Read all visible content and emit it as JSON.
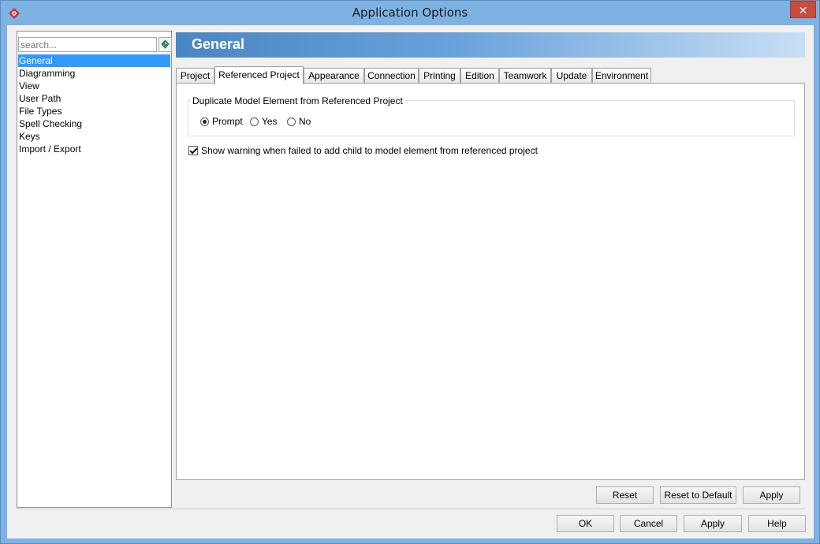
{
  "window": {
    "title": "Application Options",
    "close_glyph": "✕"
  },
  "search": {
    "placeholder": "search..."
  },
  "tree": {
    "items": [
      {
        "label": "General",
        "selected": true
      },
      {
        "label": "Diagramming"
      },
      {
        "label": "View"
      },
      {
        "label": "User Path"
      },
      {
        "label": "File Types"
      },
      {
        "label": "Spell Checking"
      },
      {
        "label": "Keys"
      },
      {
        "label": "Import / Export"
      }
    ]
  },
  "header": {
    "title": "General"
  },
  "tabs": [
    {
      "label": "Project"
    },
    {
      "label": "Referenced Project",
      "active": true
    },
    {
      "label": "Appearance"
    },
    {
      "label": "Connection"
    },
    {
      "label": "Printing"
    },
    {
      "label": "Edition"
    },
    {
      "label": "Teamwork"
    },
    {
      "label": "Update"
    },
    {
      "label": "Environment"
    }
  ],
  "duplicate_group": {
    "title": "Duplicate Model Element from Referenced Project",
    "options": [
      {
        "label": "Prompt",
        "selected": true
      },
      {
        "label": "Yes",
        "selected": false
      },
      {
        "label": "No",
        "selected": false
      }
    ]
  },
  "warning_checkbox": {
    "label": "Show warning when failed to add child to model element from referenced project",
    "checked": true
  },
  "panel_buttons": {
    "reset": "Reset",
    "reset_default": "Reset to Default",
    "apply": "Apply"
  },
  "dialog_buttons": {
    "ok": "OK",
    "cancel": "Cancel",
    "apply": "Apply",
    "help": "Help"
  },
  "colors": {
    "title_bar": "#7eb2e3",
    "selection": "#3399ff",
    "close_button": "#c94c3f",
    "banner_start": "#4a86c4"
  }
}
